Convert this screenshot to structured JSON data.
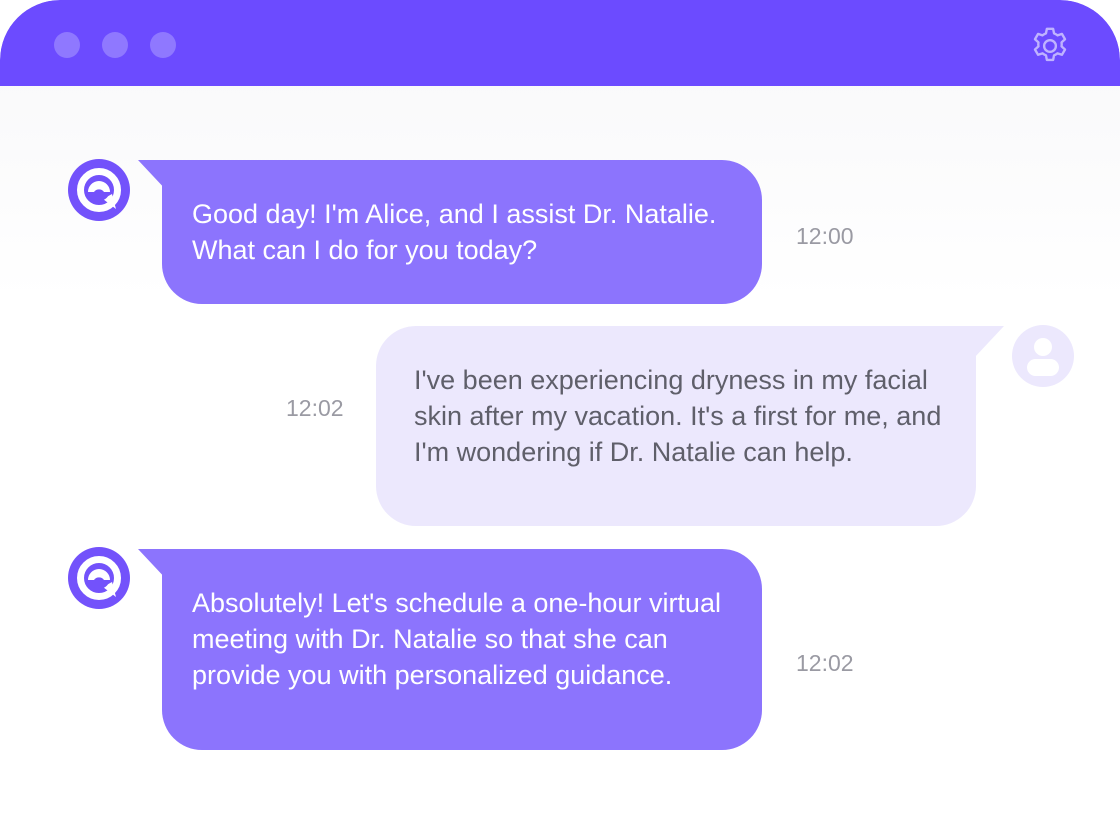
{
  "window": {
    "accent_color": "#6c4bff",
    "icons": [
      "window-dot-icon",
      "gear-icon"
    ]
  },
  "messages": [
    {
      "sender": "bot",
      "avatar_icon": "chat-bubble-logo-icon",
      "text": "Good day! I'm Alice, and I assist Dr. Natalie. What can I do for you today?",
      "time": "12:00"
    },
    {
      "sender": "user",
      "avatar_icon": "user-avatar-icon",
      "text": "I've been experiencing dryness in my facial skin after my vacation. It's a first for me, and I'm wondering if Dr. Natalie can help.",
      "time": "12:02"
    },
    {
      "sender": "bot",
      "avatar_icon": "chat-bubble-logo-icon",
      "text": "Absolutely! Let's schedule a one-hour virtual meeting with Dr. Natalie so that she can provide you with personalized guidance.",
      "time": "12:02"
    }
  ],
  "colors": {
    "bot_bubble": "#8c74fd",
    "user_bubble": "#ece8fd",
    "bot_text": "#ffffff",
    "user_text": "#5f5f6a",
    "timestamp": "#9a9aa3"
  }
}
